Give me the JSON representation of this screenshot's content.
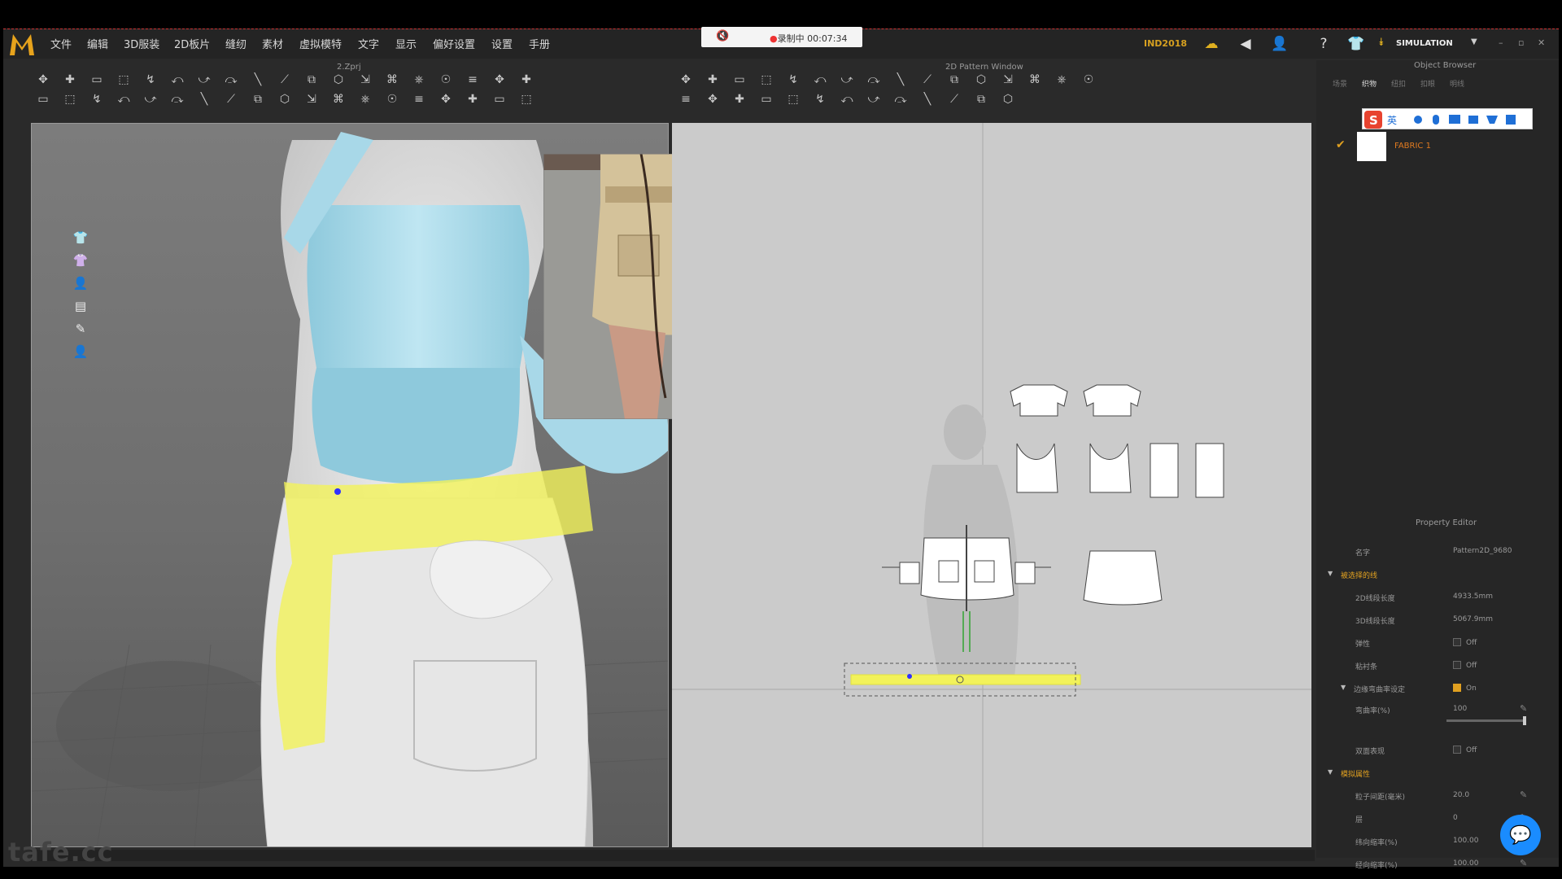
{
  "menu": [
    "文件",
    "编辑",
    "3D服装",
    "2D板片",
    "缝纫",
    "素材",
    "虚拟模特",
    "文字",
    "显示",
    "偏好设置",
    "设置",
    "手册"
  ],
  "recording": {
    "status": "录制中",
    "time": "00:07:34"
  },
  "version": "IND2018",
  "mode": "SIMULATION",
  "panels": {
    "view3d_title": "2.Zprj",
    "view2d_title": "2D Pattern Window",
    "object_browser_title": "Object Browser",
    "property_editor_title": "Property Editor"
  },
  "object_browser": {
    "tabs": [
      "场景",
      "织物",
      "纽扣",
      "扣眼",
      "明线"
    ],
    "fabric": {
      "name": "FABRIC 1",
      "color": "#ffffff"
    }
  },
  "property_editor": {
    "rows": [
      {
        "key": "名字",
        "value": "Pattern2D_9680"
      },
      {
        "key": "被选择的线",
        "value": "",
        "section": true
      },
      {
        "key": "2D线段长度",
        "value": "4933.5mm"
      },
      {
        "key": "3D线段长度",
        "value": "5067.9mm"
      },
      {
        "key": "弹性",
        "value": "Off",
        "checkbox": false
      },
      {
        "key": "粘衬条",
        "value": "Off",
        "checkbox": false
      },
      {
        "key": "边缘弯曲率设定",
        "value": "On",
        "checkbox": true,
        "sub": true
      },
      {
        "key": "弯曲率(%)",
        "value": "100"
      },
      {
        "key": "双面表现",
        "value": "Off",
        "checkbox": false
      },
      {
        "key": "模拟属性",
        "value": "",
        "section": true
      },
      {
        "key": "粒子间距(毫米)",
        "value": "20.0"
      },
      {
        "key": "层",
        "value": "0"
      },
      {
        "key": "纬向缩率(%)",
        "value": "100.00"
      },
      {
        "key": "经向缩率(%)",
        "value": "100.00"
      }
    ],
    "bend_ratio_percent": 100
  },
  "watermark": "tafe.cc",
  "colors": {
    "accent": "#e0a020",
    "shirt": "#a8d8e8",
    "selected_pattern": "#f2f25a",
    "fabric_label": "#e07a20"
  },
  "icons": {
    "toolbar_3d": [
      "move-gizmo-icon",
      "select-icon",
      "transform-icon",
      "box-select-icon",
      "edit-curve-icon",
      "sew-icon",
      "segment-sew-icon",
      "pin-icon",
      "tack-icon",
      "fold-icon",
      "arrange-icon",
      "measure-icon",
      "avatar-icon",
      "zip-icon",
      "button-icon",
      "hanger-icon",
      "layer-icon"
    ],
    "toolbar_2d": [
      "select-pattern-icon",
      "transform-pattern-icon",
      "edit-point-icon",
      "polygon-icon",
      "rectangle-icon",
      "circle-icon",
      "dart-icon",
      "internal-line-icon",
      "trace-icon",
      "seam-allowance-icon",
      "grading-icon",
      "symmetry-icon"
    ],
    "view_tools": [
      "shirt-icon",
      "shirt-alt-icon",
      "avatar-icon",
      "texture-icon",
      "pen-icon",
      "user-icon"
    ]
  }
}
